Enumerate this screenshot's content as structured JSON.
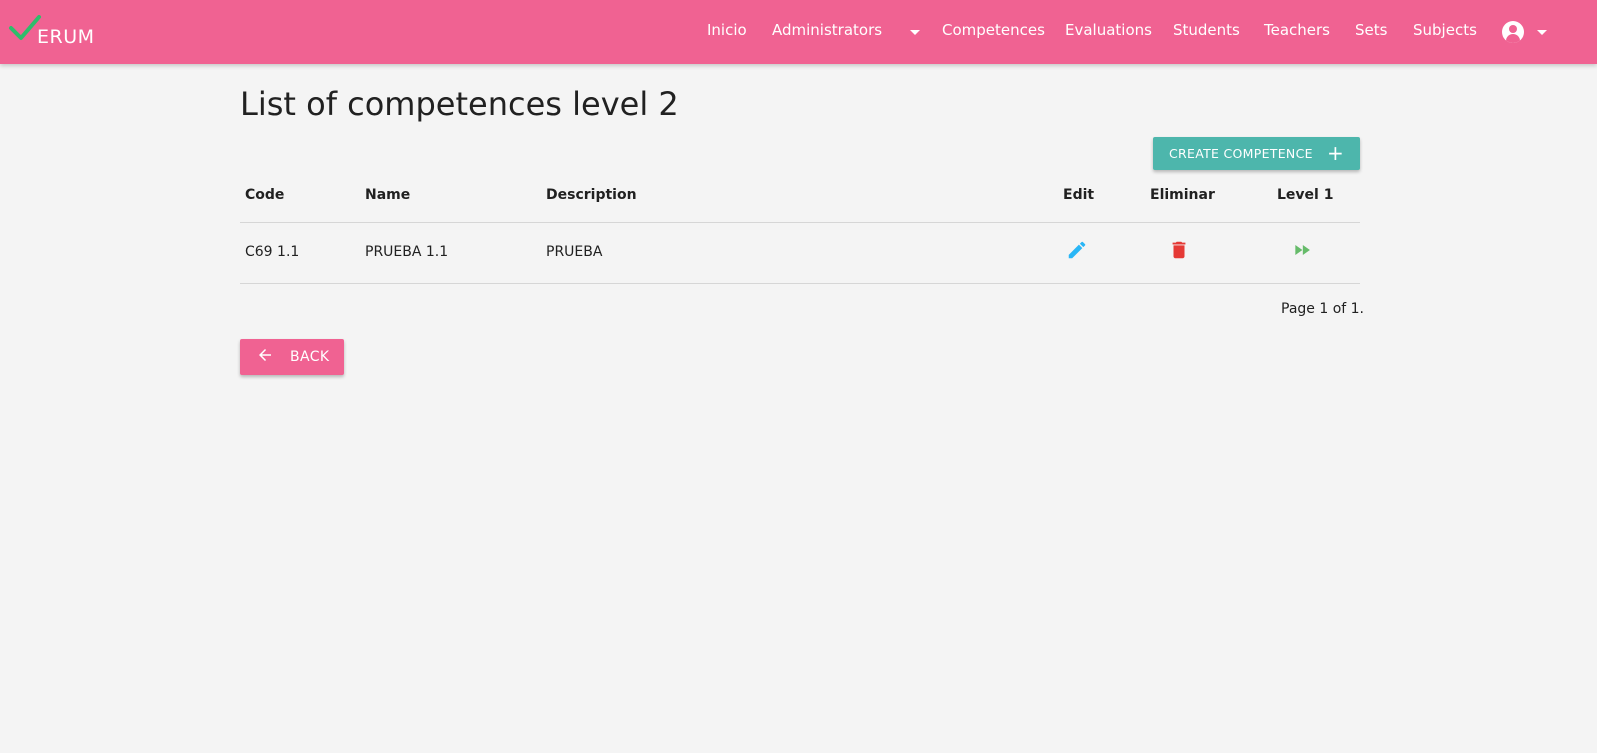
{
  "app": {
    "logo_text": "ERUM",
    "brand_color": "#f06292",
    "check_color": "#2ebd6b"
  },
  "nav": {
    "items": [
      {
        "label": "Inicio"
      },
      {
        "label": "Administrators"
      },
      {
        "label": "Competences"
      },
      {
        "label": "Evaluations"
      },
      {
        "label": "Students"
      },
      {
        "label": "Teachers"
      },
      {
        "label": "Sets"
      },
      {
        "label": "Subjects"
      }
    ],
    "account_icon": "account-circle-icon"
  },
  "page": {
    "title": "List of competences level 2",
    "create_button": "CREATE COMPETENCE",
    "create_icon": "plus-icon",
    "back_button": "BACK",
    "back_icon": "arrow-left-icon",
    "pagination": "Page 1 of 1."
  },
  "table": {
    "columns": [
      "Code",
      "Name",
      "Description",
      "Edit",
      "Eliminar",
      "Level 1"
    ],
    "rows": [
      {
        "code": "C69 1.1",
        "name": "PRUEBA 1.1",
        "description": "PRUEBA",
        "edit_icon": "pencil-icon",
        "delete_icon": "trash-icon",
        "level_icon": "fast-forward-icon"
      }
    ]
  },
  "colors": {
    "accent_teal": "#4db6ac",
    "edit_blue": "#29b6f6",
    "delete_red": "#e53935",
    "level_green": "#66bb6a"
  }
}
